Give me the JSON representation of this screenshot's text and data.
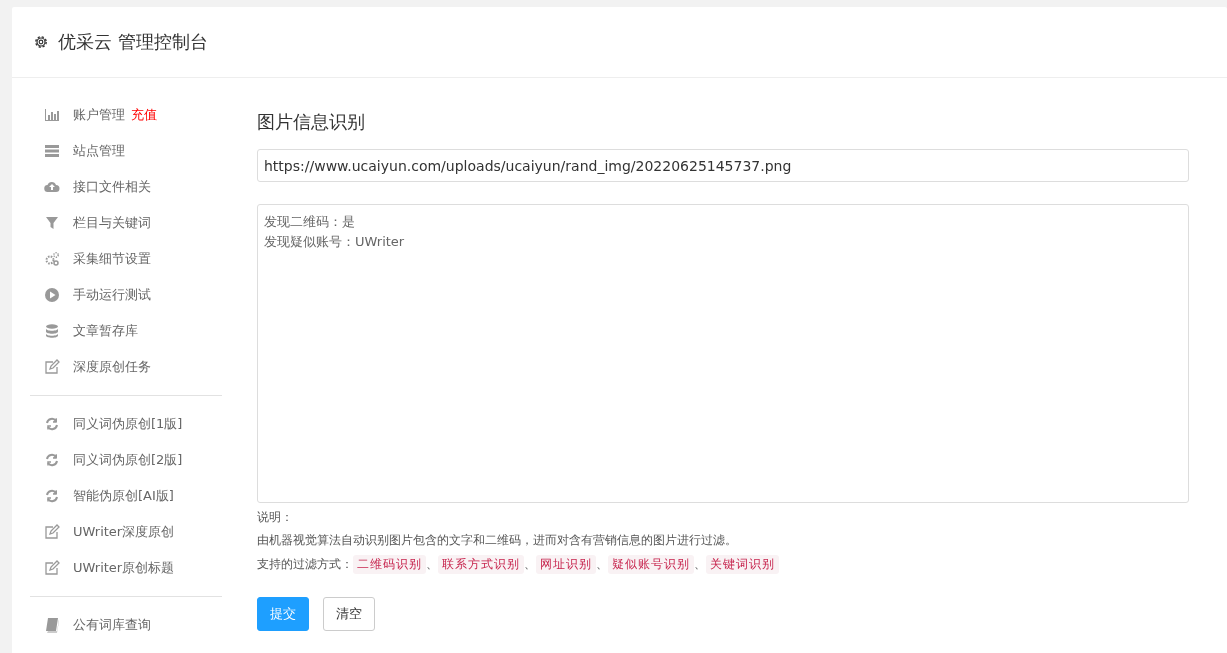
{
  "header": {
    "title": "优采云 管理控制台"
  },
  "sidebar": {
    "groups": [
      [
        {
          "label": "账户管理",
          "badge": "充值"
        },
        {
          "label": "站点管理"
        },
        {
          "label": "接口文件相关"
        },
        {
          "label": "栏目与关键词"
        },
        {
          "label": "采集细节设置"
        },
        {
          "label": "手动运行测试"
        },
        {
          "label": "文章暂存库"
        },
        {
          "label": "深度原创任务"
        }
      ],
      [
        {
          "label": "同义词伪原创[1版]"
        },
        {
          "label": "同义词伪原创[2版]"
        },
        {
          "label": "智能伪原创[AI版]"
        },
        {
          "label": "UWriter深度原创"
        },
        {
          "label": "UWriter原创标题"
        }
      ],
      [
        {
          "label": "公有词库查询"
        }
      ]
    ]
  },
  "main": {
    "title": "图片信息识别",
    "url_field": {
      "value": "https://www.ucaiyun.com/uploads/ucaiyun/rand_img/20220625145737.png"
    },
    "result_lines": [
      "发现二维码：是",
      "发现疑似账号：UWriter"
    ],
    "notes_title": "说明：",
    "description": "由机器视觉算法自动识别图片包含的文字和二维码，进而对含有营销信息的图片进行过滤。",
    "filters_label": "支持的过滤方式：",
    "filters": [
      "二维码识别",
      "联系方式识别",
      "网址识别",
      "疑似账号识别",
      "关键词识别"
    ],
    "separator": "、",
    "buttons": [
      {
        "label": "提交",
        "kind": "primary"
      },
      {
        "label": "清空",
        "kind": "default"
      }
    ]
  }
}
